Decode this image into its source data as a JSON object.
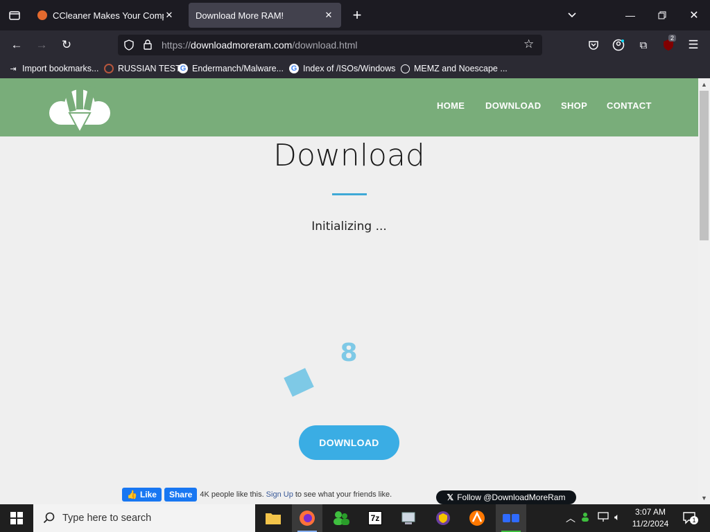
{
  "browser": {
    "tabs": [
      {
        "title": "CCleaner Makes Your Computer"
      },
      {
        "title": "Download More RAM!",
        "active": true
      }
    ],
    "url": {
      "prefix": "https://",
      "domain": "downloadmoreram.com",
      "path": "/download.html"
    },
    "bookmarks": [
      {
        "label": "Import bookmarks..."
      },
      {
        "label": "RUSSIAN TEST"
      },
      {
        "label": "Endermanch/Malware..."
      },
      {
        "label": "Index of /ISOs/Windows"
      },
      {
        "label": "MEMZ and Noescape ..."
      }
    ],
    "extension_badge": "2"
  },
  "site": {
    "nav": [
      "HOME",
      "DOWNLOAD",
      "SHOP",
      "CONTACT"
    ],
    "title": "Download",
    "status": "Initializing ...",
    "counter": "8",
    "download_button": "DOWNLOAD",
    "facebook": {
      "like": "Like",
      "share": "Share",
      "count_text": "4K people like this.",
      "signup": "Sign Up",
      "suffix": "to see what your friends like."
    },
    "twitter_follow": "Follow @DownloadMoreRam",
    "colors": {
      "header": "#79ad7a",
      "accent": "#3aade4"
    }
  },
  "taskbar": {
    "search_placeholder": "Type here to search",
    "time": "3:07 AM",
    "date": "11/2/2024",
    "notification_count": "1"
  }
}
